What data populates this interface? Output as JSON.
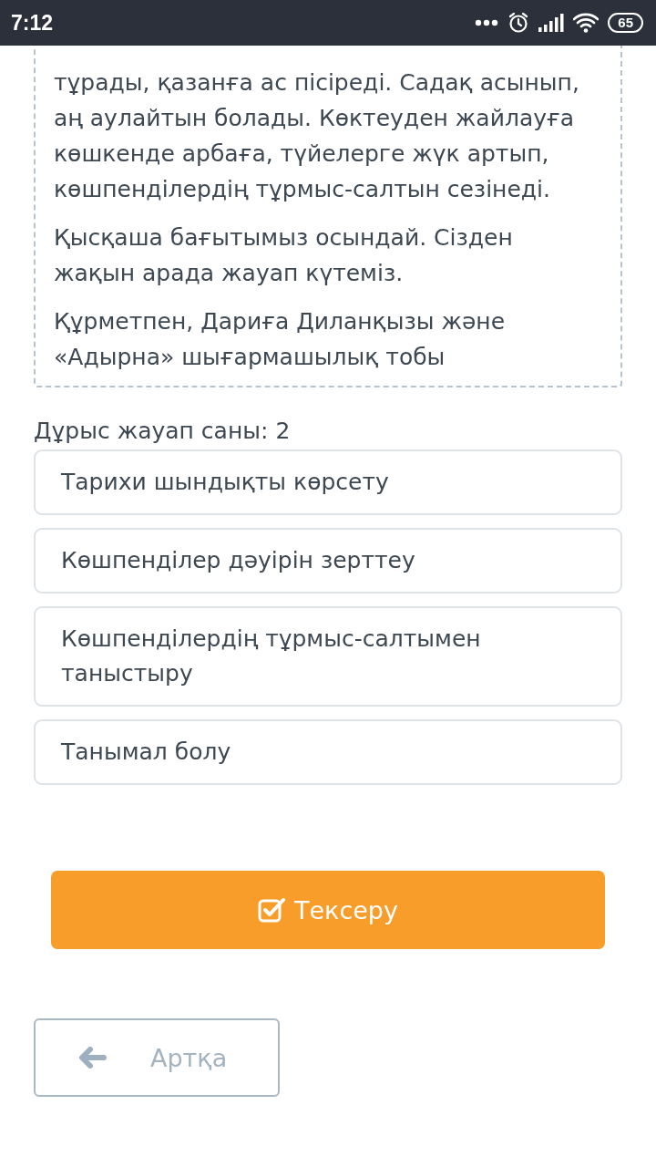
{
  "status_bar": {
    "time": "7:12",
    "battery": "65"
  },
  "letter": {
    "paragraphs": [
      "тұрады, қазанға ас пісіреді. Садақ асынып, аң аулайтын болады. Көктеуден жайлауға көшкенде арбаға, түйелерге жүк артып, көшпенділердің тұрмыс-салтын сезінеді.",
      "Қысқаша бағытымыз осындай. Сізден жақын арада жауап күтеміз.",
      "Құрметпен, Дариға Диланқызы және «Адырна» шығармашылық тобы"
    ]
  },
  "answer_count": "Дұрыс жауап саны: 2",
  "options": [
    {
      "label": "Тарихи шындықты көрсету",
      "selected": false
    },
    {
      "label": "Көшпенділер дәуірін зерттеу",
      "selected": false
    },
    {
      "label": "Көшпенділердің тұрмыс-салтымен таныстыру",
      "selected": false
    },
    {
      "label": "Танымал болу",
      "selected": false
    }
  ],
  "check_button": "Тексеру",
  "back_button": "Артқа"
}
